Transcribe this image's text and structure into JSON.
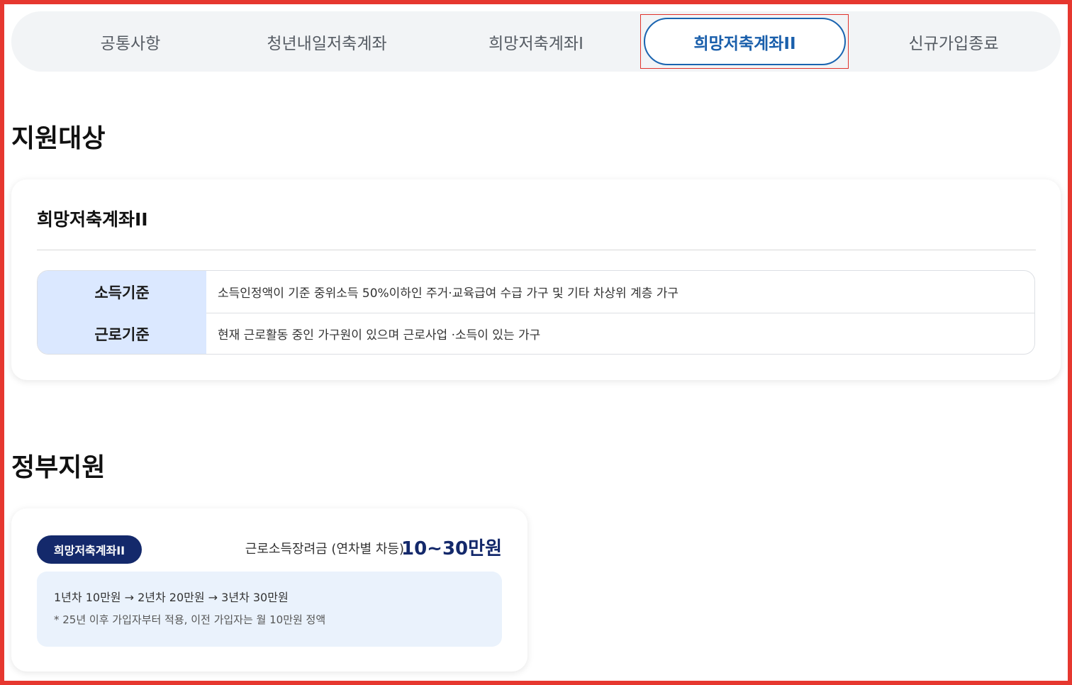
{
  "tabs": [
    {
      "label": "공통사항"
    },
    {
      "label": "청년내일저축계좌"
    },
    {
      "label": "희망저축계좌I"
    },
    {
      "label": "희망저축계좌II",
      "active": true
    },
    {
      "label": "신규가입종료"
    }
  ],
  "colors": {
    "active_tab_text": "#1a5fab",
    "active_tab_border": "#1a64b0",
    "table_header_bg": "#dbe8ff",
    "badge_bg": "#14296b",
    "detail_bg": "#eaf2fc",
    "highlight_border": "#e0322b"
  },
  "eligibility": {
    "section_title": "지원대상",
    "card_title": "희망저축계좌II",
    "rows": [
      {
        "label": "소득기준",
        "value": "소득인정액이 기준 중위소득 50%이하인 주거·교육급여 수급 가구 및 기타 차상위 계층 가구"
      },
      {
        "label": "근로기준",
        "value": "현재 근로활동 중인 가구원이 있으며 근로사업 ·소득이 있는 가구"
      }
    ]
  },
  "support": {
    "section_title": "정부지원",
    "badge": "희망저축계좌II",
    "award_label": "근로소득장려금 (연차별 차등)",
    "award_amount": "10~30만원",
    "detail_line1": "1년차 10만원 → 2년차 20만원 → 3년차 30만원",
    "detail_line2": "* 25년 이후 가입자부터 적용, 이전 가입자는 월 10만원 정액"
  }
}
